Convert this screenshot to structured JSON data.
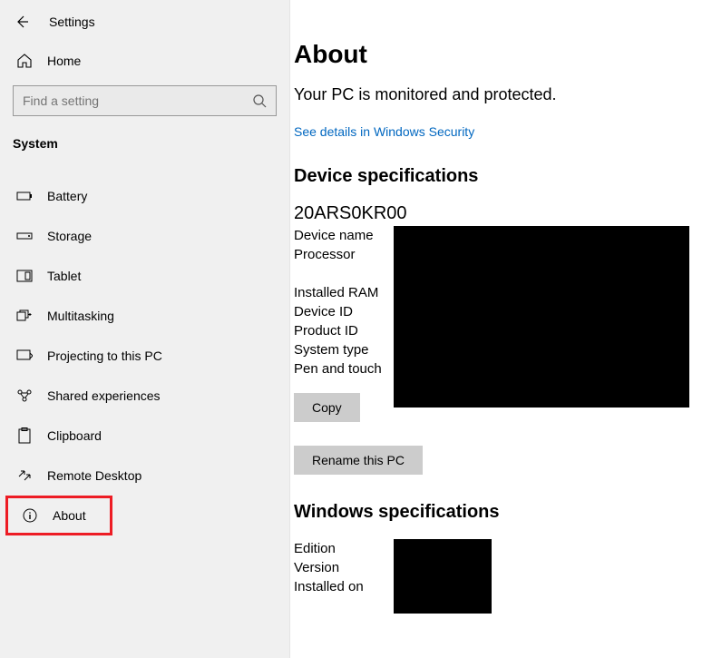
{
  "window": {
    "title": "Settings"
  },
  "sidebar": {
    "home": "Home",
    "search_placeholder": "Find a setting",
    "section": "System",
    "items": [
      {
        "label": "Battery"
      },
      {
        "label": "Storage"
      },
      {
        "label": "Tablet"
      },
      {
        "label": "Multitasking"
      },
      {
        "label": "Projecting to this PC"
      },
      {
        "label": "Shared experiences"
      },
      {
        "label": "Clipboard"
      },
      {
        "label": "Remote Desktop"
      },
      {
        "label": "About"
      }
    ]
  },
  "main": {
    "title": "About",
    "protected": "Your PC is monitored and protected.",
    "security_link": "See details in Windows Security",
    "device_spec_heading": "Device specifications",
    "device_model": "20ARS0KR00",
    "device_labels": {
      "name": "Device name",
      "processor": "Processor",
      "ram": "Installed RAM",
      "device_id": "Device ID",
      "product_id": "Product ID",
      "system_type": "System type",
      "pen_touch": "Pen and touch"
    },
    "copy_btn": "Copy",
    "rename_btn": "Rename this PC",
    "win_spec_heading": "Windows specifications",
    "win_labels": {
      "edition": "Edition",
      "version": "Version",
      "installed_on": "Installed on"
    }
  }
}
